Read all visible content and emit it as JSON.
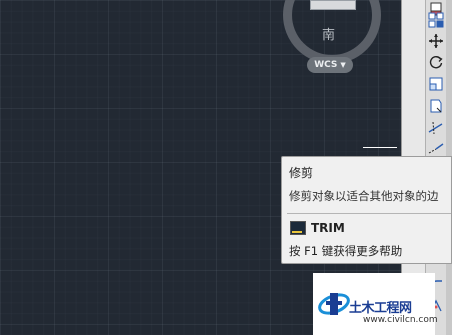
{
  "viewcube": {
    "compass_label": "南"
  },
  "ucs": {
    "label": "WCS",
    "menu_glyph": "▼"
  },
  "toolbar": {
    "tools": [
      {
        "icon": "trim-icon"
      }
    ]
  },
  "tooltip": {
    "title": "修剪",
    "description": "修剪对象以适合其他对象的边",
    "command": "TRIM",
    "help": "按 F1 键获得更多帮助"
  },
  "watermark": {
    "name": "土木工程网",
    "url": "www.civilcn.com"
  },
  "colors": {
    "canvas": "#222933",
    "tooltip_bg": "#f0f0f0",
    "watermark_blue": "#1a3d93"
  }
}
